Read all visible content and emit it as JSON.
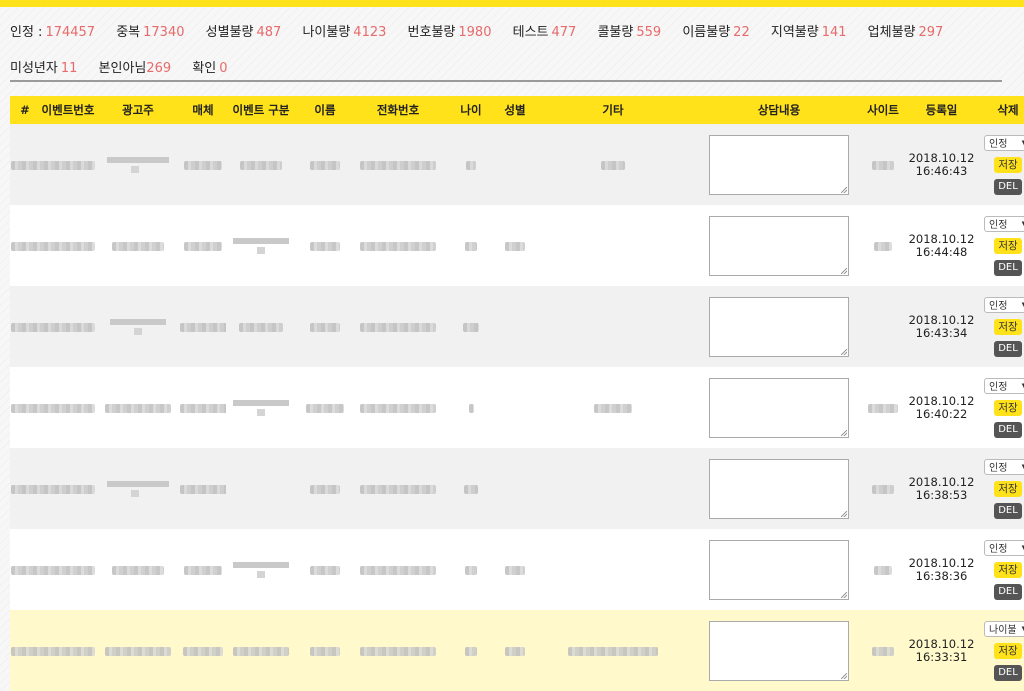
{
  "stats": [
    {
      "label": "인정 :",
      "value": "174457"
    },
    {
      "label": "중복",
      "value": "17340"
    },
    {
      "label": "성별불량",
      "value": "487"
    },
    {
      "label": "나이불량",
      "value": "4123"
    },
    {
      "label": "번호불량",
      "value": "1980"
    },
    {
      "label": "테스트",
      "value": "477"
    },
    {
      "label": "콜불량",
      "value": "559"
    },
    {
      "label": "이름불량",
      "value": "22"
    },
    {
      "label": "지역불량",
      "value": "141"
    },
    {
      "label": "업체불량",
      "value": "297"
    },
    {
      "label": "미성년자",
      "value": "11"
    },
    {
      "label": "본인아님",
      "value": "269"
    },
    {
      "label": "확인",
      "value": "0"
    }
  ],
  "table": {
    "headers": [
      "#",
      "이벤트번호",
      "광고주",
      "매체",
      "이벤트 구분",
      "이름",
      "전화번호",
      "나이",
      "성별",
      "기타",
      "상담내용",
      "사이트",
      "등록일",
      "삭제"
    ],
    "save_label": "저장",
    "del_label": "DEL",
    "rows": [
      {
        "date": "2018.10.12",
        "time": "16:46:43",
        "status": "인정"
      },
      {
        "date": "2018.10.12",
        "time": "16:44:48",
        "status": "인정"
      },
      {
        "date": "2018.10.12",
        "time": "16:43:34",
        "status": "인정"
      },
      {
        "date": "2018.10.12",
        "time": "16:40:22",
        "status": "인정"
      },
      {
        "date": "2018.10.12",
        "time": "16:38:53",
        "status": "인정"
      },
      {
        "date": "2018.10.12",
        "time": "16:38:36",
        "status": "인정"
      },
      {
        "date": "2018.10.12",
        "time": "16:33:31",
        "status": "나이불"
      }
    ]
  }
}
